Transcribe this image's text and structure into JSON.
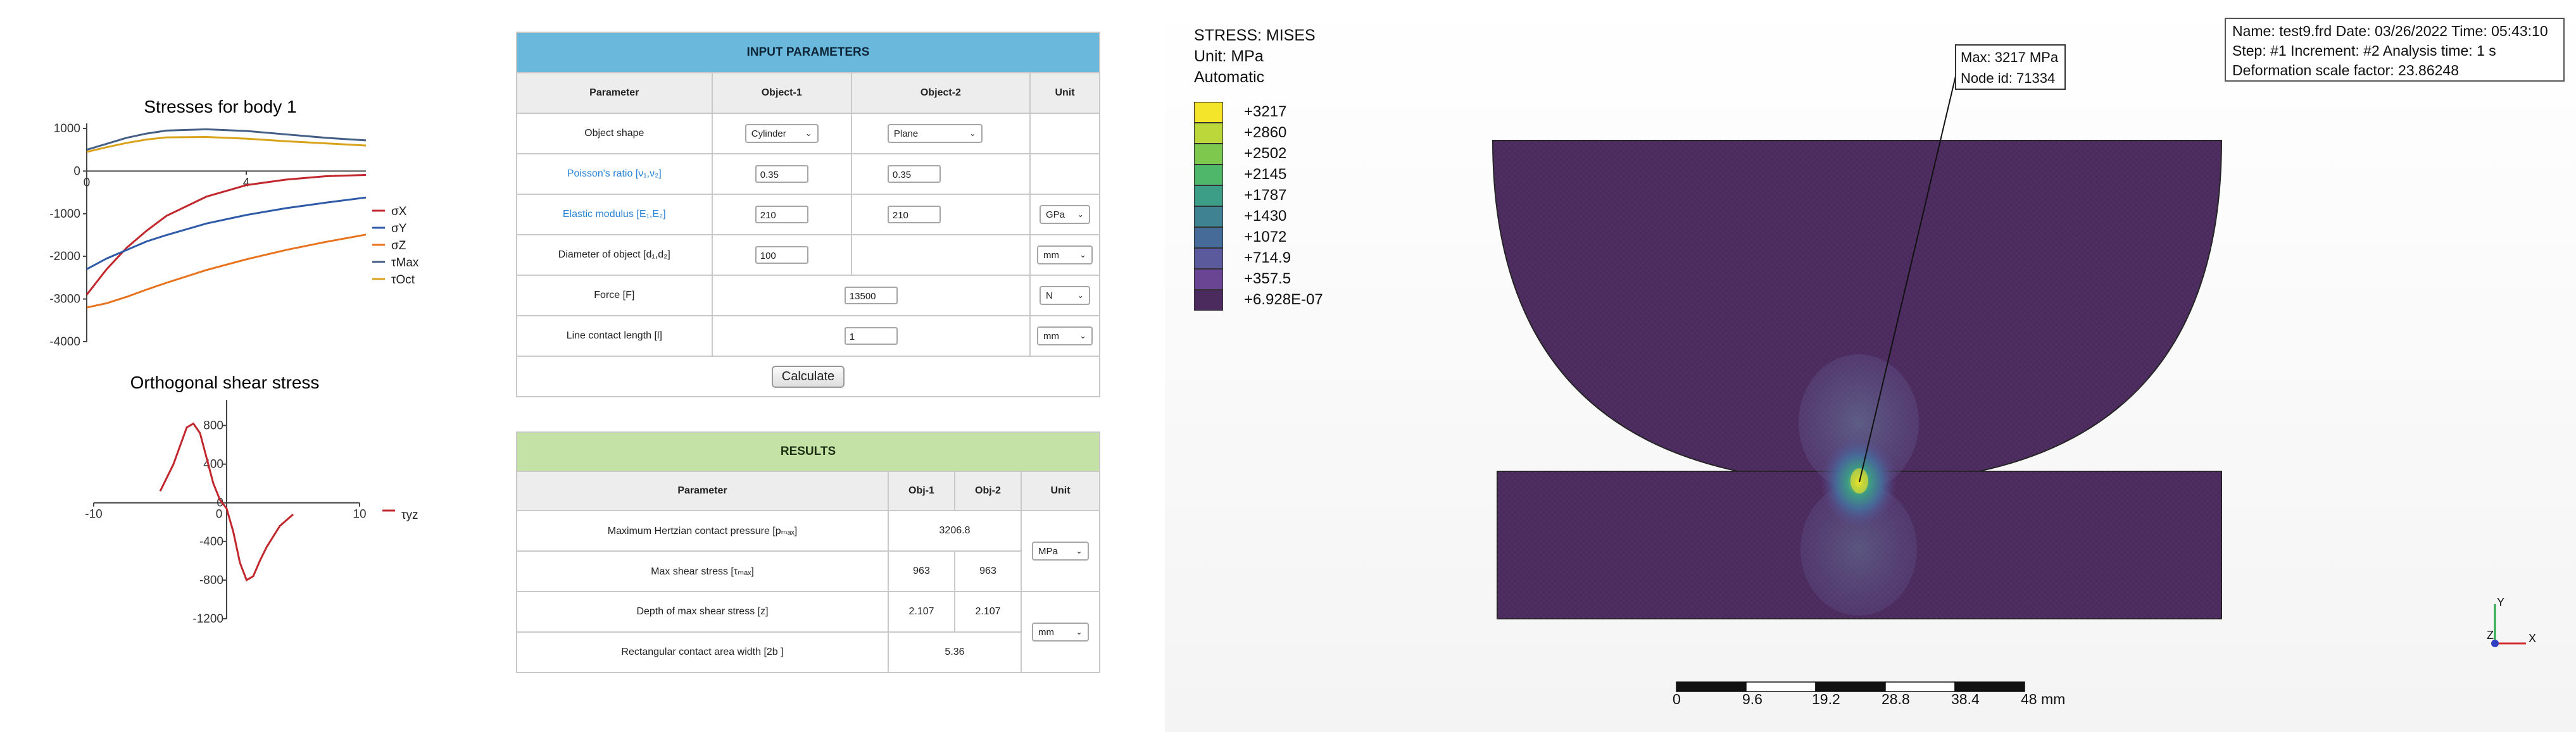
{
  "left_panel": {
    "chart1": {
      "title": "Stresses for body 1",
      "x_ticks": [
        "0",
        "4"
      ],
      "y_ticks": [
        "1000",
        "0",
        "-1000",
        "-2000",
        "-3000",
        "-4000"
      ],
      "legend": [
        {
          "label": "σX",
          "color": "#c1272d"
        },
        {
          "label": "σY",
          "color": "#2f5aa8"
        },
        {
          "label": "σZ",
          "color": "#e8731e"
        },
        {
          "label": "τMax",
          "color": "#445f85"
        },
        {
          "label": "τOct",
          "color": "#d9a21b"
        }
      ]
    },
    "chart2": {
      "title": "Orthogonal shear stress",
      "x_ticks": [
        "-10",
        "0",
        "10"
      ],
      "y_ticks": [
        "800",
        "400",
        "0",
        "-400",
        "-800",
        "-1200"
      ],
      "legend": [
        {
          "label": "τyz",
          "color": "#c1272d"
        }
      ]
    }
  },
  "chart_data": [
    {
      "type": "line",
      "title": "Stresses for body 1",
      "xlim": [
        0,
        7
      ],
      "ylim": [
        -4000,
        1000
      ],
      "series": [
        {
          "name": "σX",
          "color": "#c1272d",
          "x": [
            0,
            0.5,
            1,
            1.5,
            2,
            3,
            4,
            5,
            6,
            7
          ],
          "y": [
            -2900,
            -2300,
            -1800,
            -1400,
            -1050,
            -600,
            -330,
            -200,
            -120,
            -90
          ]
        },
        {
          "name": "σY",
          "color": "#2f5aa8",
          "x": [
            0,
            0.5,
            1,
            1.5,
            2,
            3,
            4,
            5,
            6,
            7
          ],
          "y": [
            -2300,
            -2050,
            -1850,
            -1650,
            -1500,
            -1230,
            -1030,
            -870,
            -740,
            -620
          ]
        },
        {
          "name": "σZ",
          "color": "#e8731e",
          "x": [
            0,
            0.5,
            1,
            1.5,
            2,
            3,
            4,
            5,
            6,
            7
          ],
          "y": [
            -3200,
            -3100,
            -2950,
            -2780,
            -2620,
            -2320,
            -2070,
            -1850,
            -1660,
            -1490
          ]
        },
        {
          "name": "τMax",
          "color": "#445f85",
          "x": [
            0,
            0.5,
            1,
            1.5,
            2,
            3,
            4,
            5,
            6,
            7
          ],
          "y": [
            500,
            640,
            780,
            880,
            950,
            980,
            940,
            860,
            780,
            720
          ]
        },
        {
          "name": "τOct",
          "color": "#d9a21b",
          "x": [
            0,
            0.5,
            1,
            1.5,
            2,
            3,
            4,
            5,
            6,
            7
          ],
          "y": [
            450,
            560,
            660,
            740,
            790,
            800,
            760,
            700,
            650,
            600
          ]
        }
      ]
    },
    {
      "type": "line",
      "title": "Orthogonal shear stress",
      "xlim": [
        -10,
        10
      ],
      "ylim": [
        -1200,
        1000
      ],
      "series": [
        {
          "name": "τyz",
          "color": "#c1272d",
          "x": [
            -5,
            -4,
            -3,
            -2.5,
            -2,
            -1.5,
            -1,
            -0.5,
            0,
            0.5,
            1,
            1.5,
            2,
            2.5,
            3,
            4,
            5
          ],
          "y": [
            120,
            400,
            780,
            820,
            720,
            460,
            200,
            30,
            -60,
            -300,
            -620,
            -800,
            -760,
            -600,
            -460,
            -240,
            -120
          ]
        }
      ]
    }
  ],
  "input_table": {
    "title": "INPUT PARAMETERS",
    "headers": [
      "Parameter",
      "Object-1",
      "Object-2",
      "Unit"
    ],
    "rows": {
      "shape": {
        "label": "Object shape",
        "obj1": "Cylinder",
        "obj2": "Plane"
      },
      "poisson": {
        "label": "Poisson's ratio [ν₁,ν₂]",
        "obj1": "0.35",
        "obj2": "0.35"
      },
      "elastic": {
        "label": "Elastic modulus [E₁,E₂]",
        "obj1": "210",
        "obj2": "210",
        "unit": "GPa"
      },
      "diameter": {
        "label": "Diameter of object [d₁,d₂]",
        "obj1": "100",
        "unit": "mm"
      },
      "force": {
        "label": "Force [F]",
        "value": "13500",
        "unit": "N"
      },
      "length": {
        "label": "Line contact length  [l]",
        "value": "1",
        "unit": "mm"
      }
    },
    "calculate_label": "Calculate"
  },
  "results_table": {
    "title": "RESULTS",
    "headers": [
      "Parameter",
      "Obj-1",
      "Obj-2",
      "Unit"
    ],
    "rows": {
      "pmax": {
        "label": "Maximum Hertzian contact pressure [pₘₐₓ]",
        "value": "3206.8"
      },
      "tau": {
        "label": "Max shear stress [τₘₐₓ]",
        "obj1": "963",
        "obj2": "963"
      },
      "depth": {
        "label": "Depth of max shear stress [z]",
        "obj1": "2.107",
        "obj2": "2.107"
      },
      "width": {
        "label": "Rectangular contact area width  [2b ]",
        "value": "5.36"
      }
    },
    "unit_pressure": "MPa",
    "unit_length": "mm"
  },
  "viewer": {
    "stress_label": "STRESS: MISES",
    "unit_label": "Unit: MPa",
    "mode_label": "Automatic",
    "info_line1": "Name: test9.frd   Date: 03/26/2022   Time: 05:43:10",
    "info_line2": "Step: #1   Increment: #2   Analysis time: 1 s",
    "info_line3": "Deformation scale factor: 23.86248",
    "max_line1": "Max: 3217 MPa",
    "max_line2": "Node id: 71334",
    "legend": [
      {
        "label": "+3217",
        "color": "#f4e52a"
      },
      {
        "label": "+2860",
        "color": "#bcd73a"
      },
      {
        "label": "+2502",
        "color": "#7ec84d"
      },
      {
        "label": "+2145",
        "color": "#4fb76a"
      },
      {
        "label": "+1787",
        "color": "#3c9e86"
      },
      {
        "label": "+1430",
        "color": "#3f8393"
      },
      {
        "label": "+1072",
        "color": "#466b99"
      },
      {
        "label": "+714.9",
        "color": "#5a5a9c"
      },
      {
        "label": "+357.5",
        "color": "#694594"
      },
      {
        "label": "+6.928E-07",
        "color": "#4b2a5e"
      }
    ],
    "scale_labels": [
      "0",
      "9.6",
      "19.2",
      "28.8",
      "38.4",
      "48 mm"
    ],
    "axes": {
      "y": "Y",
      "z": "Z",
      "x": "X"
    }
  }
}
